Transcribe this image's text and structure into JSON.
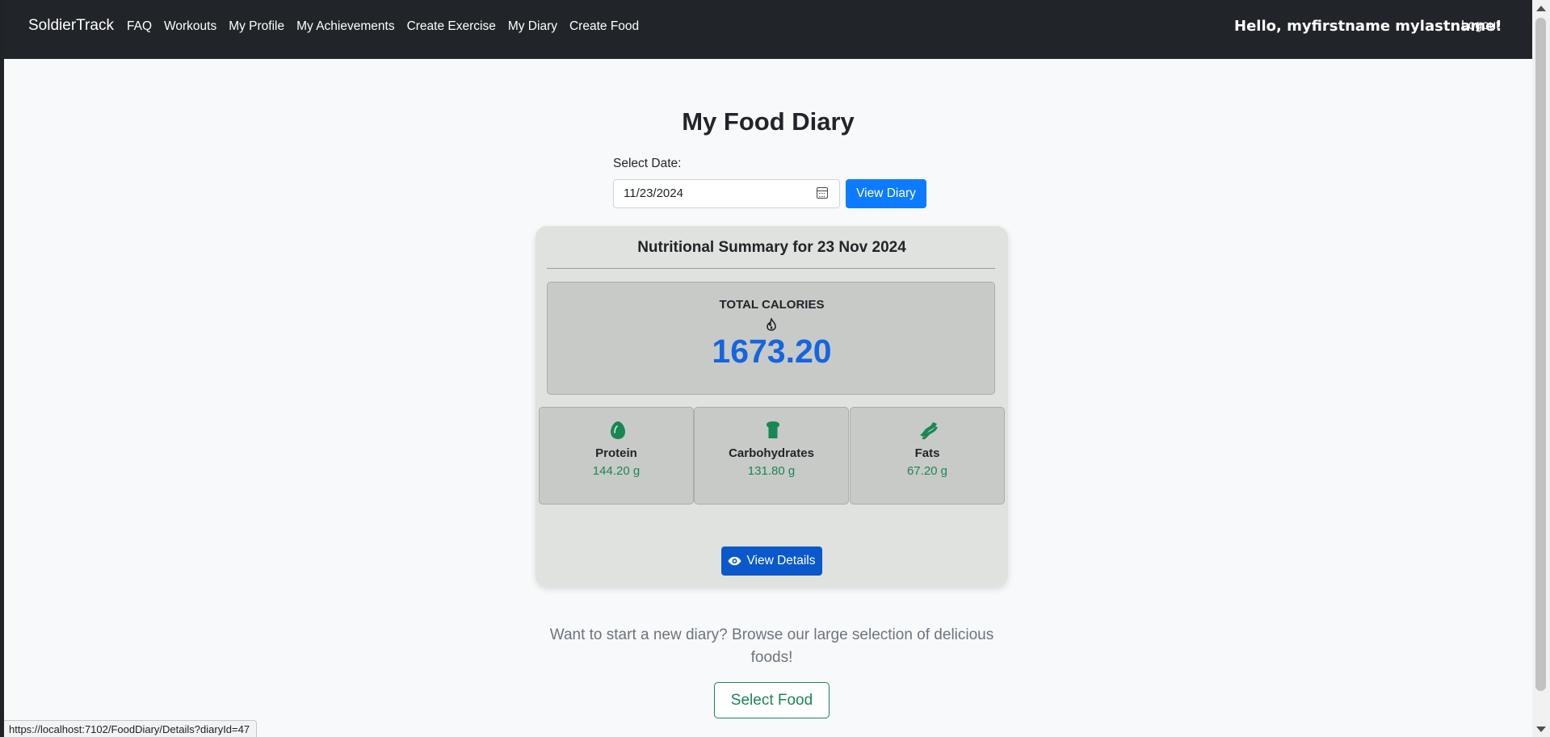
{
  "navbar": {
    "brand": "SoldierTrack",
    "links": [
      "FAQ",
      "Workouts",
      "My Profile",
      "My Achievements",
      "Create Exercise",
      "My Diary",
      "Create Food"
    ],
    "greeting": "Hello, myfirstname mylastname!",
    "logout": "Logout"
  },
  "page": {
    "title": "My Food Diary",
    "date_label": "Select Date:",
    "date_value": "11/23/2024",
    "view_diary": "View Diary"
  },
  "summary": {
    "title": "Nutritional Summary for 23 Nov 2024",
    "total_label": "TOTAL CALORIES",
    "total_value": "1673.20",
    "macros": [
      {
        "name": "Protein",
        "value": "144.20 g",
        "icon": "egg-icon"
      },
      {
        "name": "Carbohydrates",
        "value": "131.80 g",
        "icon": "bread-icon"
      },
      {
        "name": "Fats",
        "value": "67.20 g",
        "icon": "bacon-icon"
      }
    ],
    "details_button": "View Details"
  },
  "cta": {
    "text": "Want to start a new diary? Browse our large selection of delicious foods!",
    "button": "Select Food"
  },
  "status_url": "https://localhost:7102/FoodDiary/Details?diaryId=47",
  "colors": {
    "navbar": "#212529",
    "primary": "#0d7bff",
    "calories": "#1565e0",
    "macro_green": "#198754"
  }
}
